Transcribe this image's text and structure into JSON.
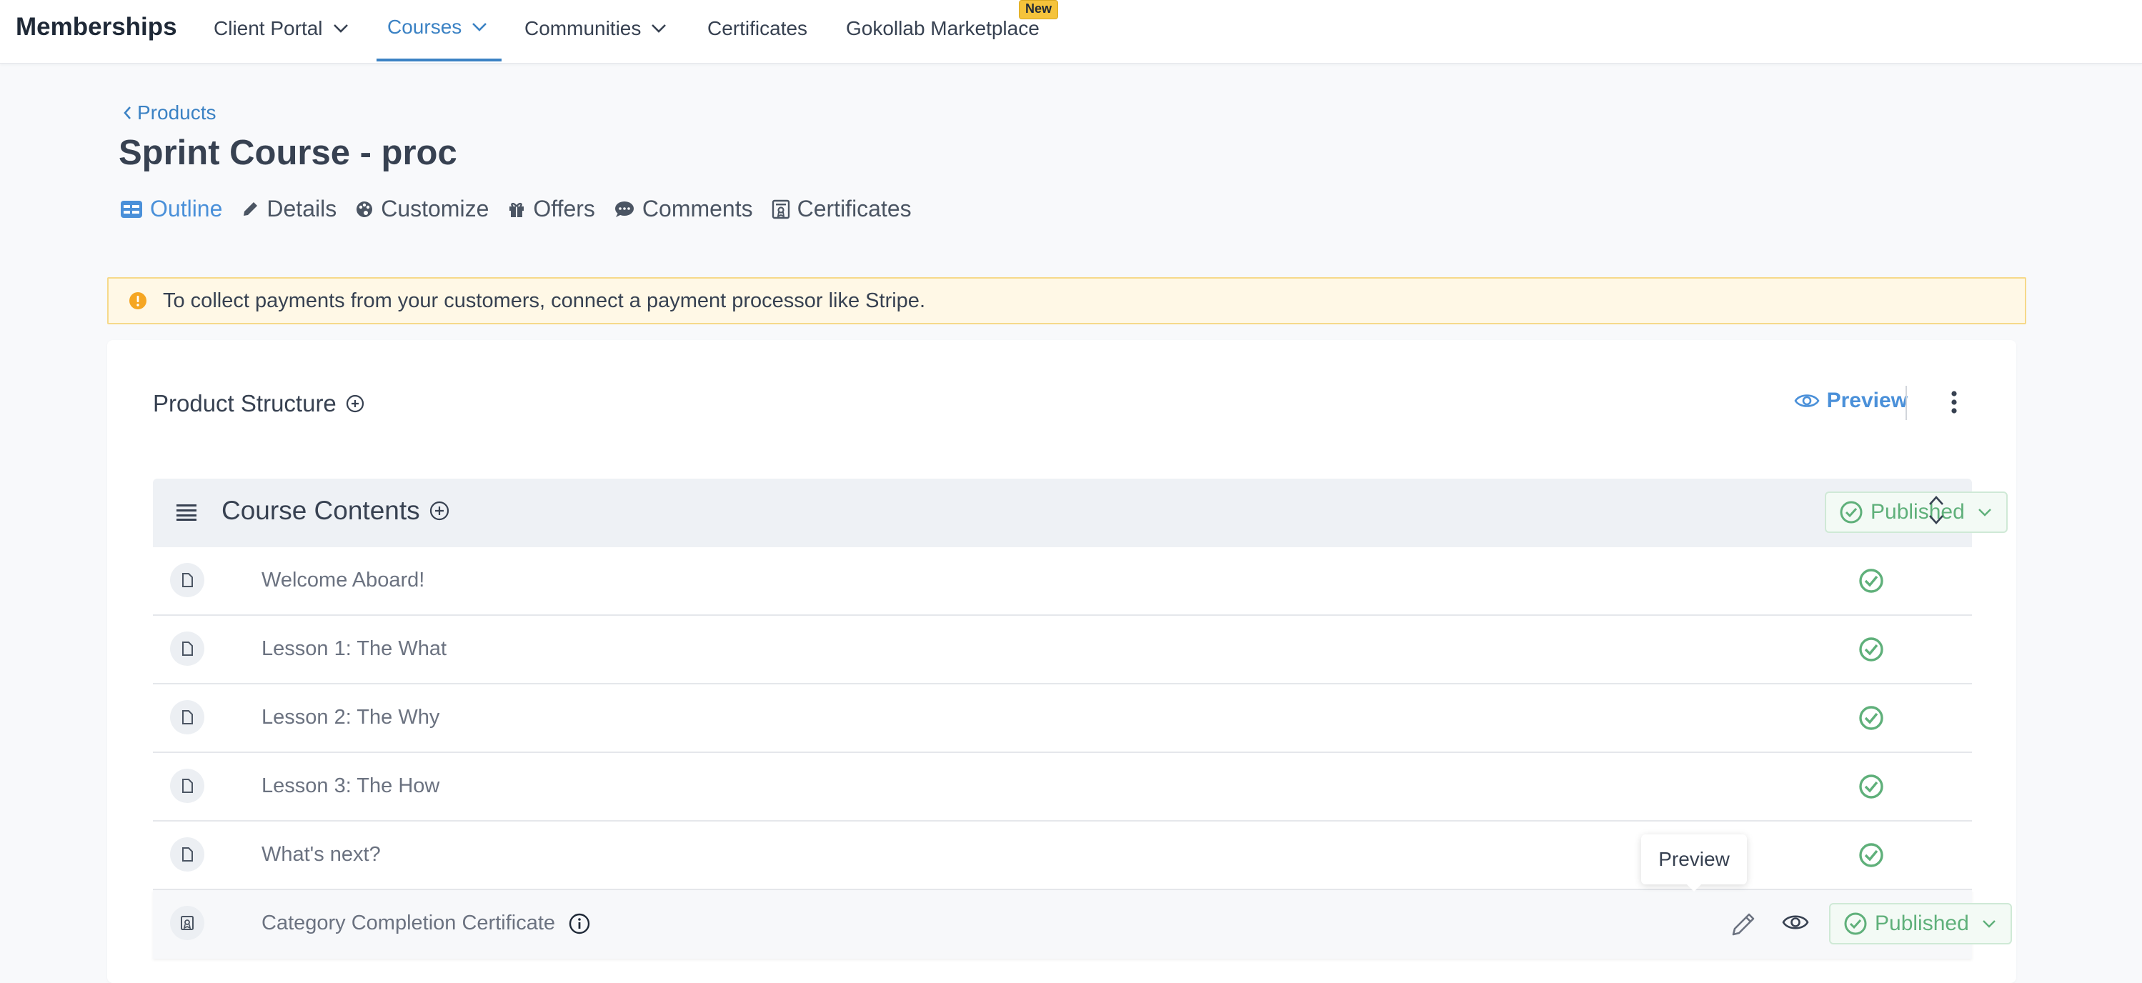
{
  "nav": {
    "brand": "Memberships",
    "items": [
      {
        "label": "Client Portal",
        "dropdown": true
      },
      {
        "label": "Courses",
        "dropdown": true,
        "active": true
      },
      {
        "label": "Communities",
        "dropdown": true
      },
      {
        "label": "Certificates",
        "dropdown": false
      },
      {
        "label": "Gokollab Marketplace",
        "dropdown": false,
        "badge": "New"
      }
    ]
  },
  "header": {
    "back_label": "Products",
    "title": "Sprint Course - proc",
    "tabs": [
      {
        "label": "Outline",
        "icon": "outline-icon",
        "active": true
      },
      {
        "label": "Details",
        "icon": "pencil-icon"
      },
      {
        "label": "Customize",
        "icon": "palette-icon"
      },
      {
        "label": "Offers",
        "icon": "gift-icon"
      },
      {
        "label": "Comments",
        "icon": "comment-icon"
      },
      {
        "label": "Certificates",
        "icon": "certificate-icon"
      }
    ]
  },
  "alert": {
    "text": "To collect payments from your customers, connect a payment processor like Stripe."
  },
  "structure": {
    "title": "Product Structure",
    "preview_label": "Preview",
    "section": {
      "title": "Course Contents",
      "status": "Published"
    },
    "rows": [
      {
        "label": "Welcome Aboard!",
        "type": "lesson",
        "published": true
      },
      {
        "label": "Lesson 1: The What",
        "type": "lesson",
        "published": true
      },
      {
        "label": "Lesson 2: The Why",
        "type": "lesson",
        "published": true
      },
      {
        "label": "Lesson 3: The How",
        "type": "lesson",
        "published": true
      },
      {
        "label": "What's next?",
        "type": "lesson",
        "published": true
      },
      {
        "label": "Category Completion Certificate",
        "type": "certificate",
        "status": "Published"
      }
    ],
    "tooltip": "Preview"
  },
  "colors": {
    "accent": "#3b82c4",
    "published_green": "#5fb07a",
    "alert_bg": "#fff8e6",
    "badge": "#f5c33b"
  }
}
